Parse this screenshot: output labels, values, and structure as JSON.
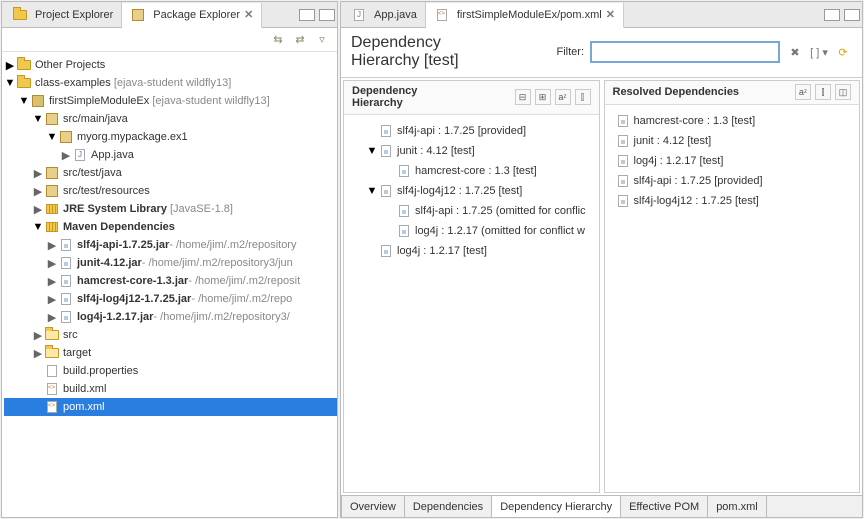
{
  "left": {
    "tabs": [
      {
        "label": "Project Explorer",
        "active": false
      },
      {
        "label": "Package Explorer",
        "active": true
      }
    ],
    "tree": {
      "other_projects": "Other Projects",
      "class_examples": {
        "name": "class-examples",
        "info": "[ejava-student wildfly13]"
      },
      "first_module": {
        "name": "firstSimpleModuleEx",
        "info": "[ejava-student wildfly13]"
      },
      "src_main_java": "src/main/java",
      "pkg": "myorg.mypackage.ex1",
      "app_java": "App.java",
      "src_test_java": "src/test/java",
      "src_test_resources": "src/test/resources",
      "jre": {
        "name": "JRE System Library",
        "info": "[JavaSE-1.8]"
      },
      "maven_deps": "Maven Dependencies",
      "jars": [
        {
          "name": "slf4j-api-1.7.25.jar",
          "info": " - /home/jim/.m2/repository"
        },
        {
          "name": "junit-4.12.jar",
          "info": " - /home/jim/.m2/repository3/jun"
        },
        {
          "name": "hamcrest-core-1.3.jar",
          "info": " - /home/jim/.m2/reposit"
        },
        {
          "name": "slf4j-log4j12-1.7.25.jar",
          "info": " - /home/jim/.m2/repo"
        },
        {
          "name": "log4j-1.2.17.jar",
          "info": " - /home/jim/.m2/repository3/"
        }
      ],
      "src": "src",
      "target": "target",
      "build_properties": "build.properties",
      "build_xml": "build.xml",
      "pom_xml": "pom.xml"
    }
  },
  "right": {
    "editor_tabs": [
      {
        "label": "App.java",
        "active": false
      },
      {
        "label": "firstSimpleModuleEx/pom.xml",
        "active": true
      }
    ],
    "header": {
      "title": "Dependency\nHierarchy [test]",
      "filter_label": "Filter:",
      "filter_value": ""
    },
    "dep_hierarchy": {
      "title": "Dependency\nHierarchy",
      "rows": [
        {
          "indent": 1,
          "tw": "",
          "text": "slf4j-api : 1.7.25 [provided]"
        },
        {
          "indent": 1,
          "tw": "▼",
          "text": "junit : 4.12 [test]"
        },
        {
          "indent": 2,
          "tw": "",
          "text": "hamcrest-core : 1.3 [test]"
        },
        {
          "indent": 1,
          "tw": "▼",
          "text": "slf4j-log4j12 : 1.7.25 [test]"
        },
        {
          "indent": 2,
          "tw": "",
          "text": "slf4j-api : 1.7.25 (omitted for conflic"
        },
        {
          "indent": 2,
          "tw": "",
          "text": "log4j : 1.2.17 (omitted for conflict w"
        },
        {
          "indent": 1,
          "tw": "",
          "text": "log4j : 1.2.17 [test]"
        }
      ]
    },
    "resolved": {
      "title": "Resolved Dependencies",
      "rows": [
        "hamcrest-core : 1.3 [test]",
        "junit : 4.12 [test]",
        "log4j : 1.2.17 [test]",
        "slf4j-api : 1.7.25 [provided]",
        "slf4j-log4j12 : 1.7.25 [test]"
      ]
    },
    "bottom_tabs": [
      {
        "label": "Overview",
        "active": false
      },
      {
        "label": "Dependencies",
        "active": false
      },
      {
        "label": "Dependency Hierarchy",
        "active": true
      },
      {
        "label": "Effective POM",
        "active": false
      },
      {
        "label": "pom.xml",
        "active": false
      }
    ]
  }
}
